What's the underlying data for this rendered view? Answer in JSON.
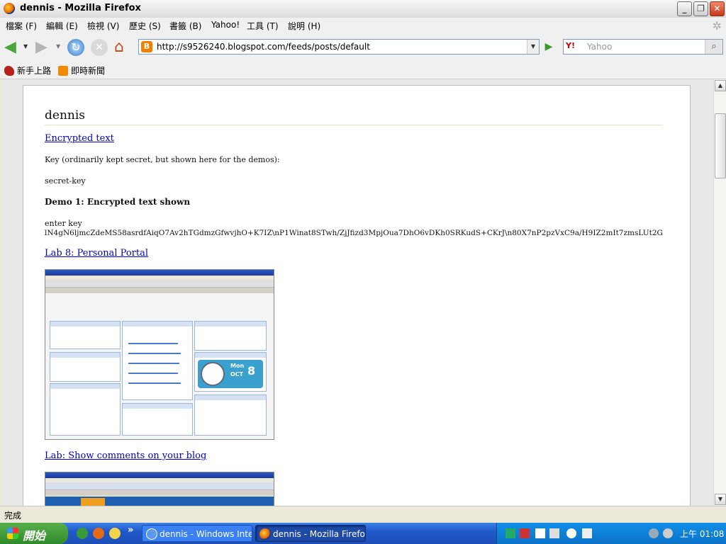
{
  "window": {
    "title": "dennis - Mozilla Firefox",
    "min_icon": "minimize-icon",
    "max_icon": "maximize-icon",
    "close_icon": "close-icon"
  },
  "menu": [
    "檔案 (F)",
    "編輯 (E)",
    "檢視 (V)",
    "歷史 (S)",
    "書籤 (B)",
    "Yahoo!",
    "工具 (T)",
    "說明 (H)"
  ],
  "nav": {
    "url": "http://s9526240.blogspot.com/feeds/posts/default",
    "search_placeholder": "Yahoo",
    "search_engine_icon": "Y!"
  },
  "bookmarks": [
    "新手上路",
    "即時新聞"
  ],
  "blog": {
    "title": "dennis",
    "posts": [
      {
        "title": "Encrypted text",
        "lines": [
          "Key (ordinarily kept secret, but shown here for the demos):",
          "secret-key"
        ],
        "subheading": "Demo 1: Encrypted text shown",
        "label": "enter key",
        "cipher": "lN4gN6ljmcZdeMS58asrdfAiqO7Av2hTGdmzGfwvjhO+K7IZ\\nP1Winat8STwh/ZjJfizd3MpjOua7DhO6vDKh0SRKudS+CKrJ\\n80X7nP2pzVxC9a/H9IZ2mIt7zmsLUt2G"
      },
      {
        "title": "Lab 8: Personal Portal"
      },
      {
        "title": "Lab: Show comments on your blog"
      }
    ],
    "thumb_clock": {
      "month": "Mon",
      "day_label": "OCT",
      "day": "8"
    }
  },
  "status": "完成",
  "taskbar": {
    "start": "開始",
    "tasks": [
      "dennis - Windows Inte...",
      "dennis - Mozilla Firefox"
    ],
    "clock": "上午 01:08"
  }
}
